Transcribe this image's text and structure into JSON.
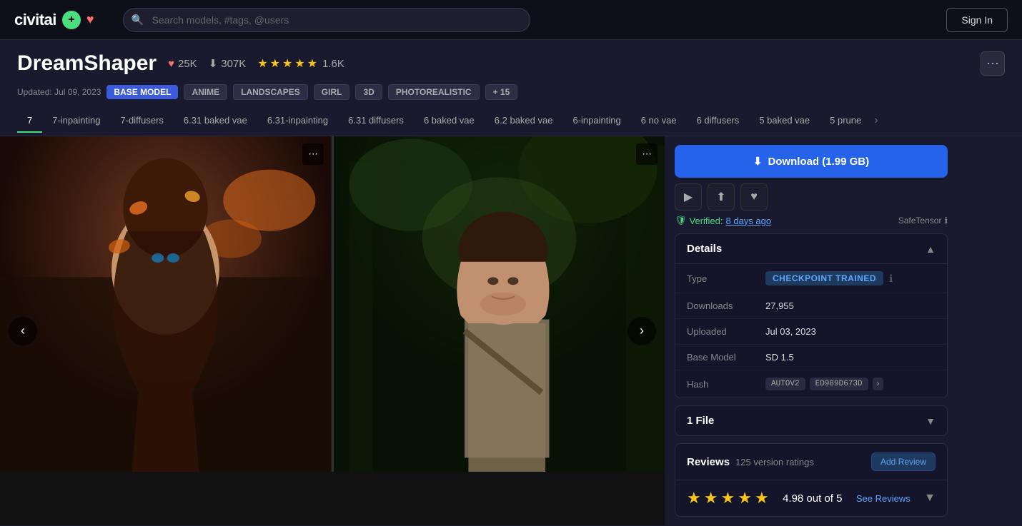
{
  "header": {
    "logo_text": "civitai",
    "search_placeholder": "Search models, #tags, @users",
    "sign_in_label": "Sign In"
  },
  "page": {
    "title": "DreamShaper",
    "likes": "25K",
    "downloads": "307K",
    "rating_stars": 5,
    "rating_count": "1.6K",
    "updated": "Updated: Jul 09, 2023",
    "tags": [
      "BASE MODEL",
      "ANIME",
      "LANDSCAPES",
      "GIRL",
      "3D",
      "PHOTOREALISTIC",
      "+15"
    ]
  },
  "version_tabs": {
    "tabs": [
      "7",
      "7-inpainting",
      "7-diffusers",
      "6.31 baked vae",
      "6.31-inpainting",
      "6.31 diffusers",
      "6 baked vae",
      "6.2 baked vae",
      "6-inpainting",
      "6 no vae",
      "6 diffusers",
      "5 baked vae",
      "5 prune"
    ],
    "active_index": 0
  },
  "download": {
    "button_label": "Download (1.99 GB)",
    "verified_text": "Verified:",
    "verified_time": "8 days ago",
    "safe_tensor_label": "SafeTensor"
  },
  "details": {
    "title": "Details",
    "rows": [
      {
        "label": "Type",
        "value": "CHECKPOINT TRAINED",
        "type": "badge"
      },
      {
        "label": "Downloads",
        "value": "27,955"
      },
      {
        "label": "Uploaded",
        "value": "Jul 03, 2023"
      },
      {
        "label": "Base Model",
        "value": "SD 1.5"
      },
      {
        "label": "Hash",
        "value": "",
        "type": "hash",
        "autov2": "AUTOV2",
        "hash_val": "ED989D673D"
      }
    ]
  },
  "files": {
    "title": "1 File"
  },
  "reviews": {
    "title": "Reviews",
    "count_label": "125 version ratings",
    "add_review_label": "Add Review",
    "score": "4.98 out of 5",
    "see_reviews_label": "See Reviews"
  }
}
